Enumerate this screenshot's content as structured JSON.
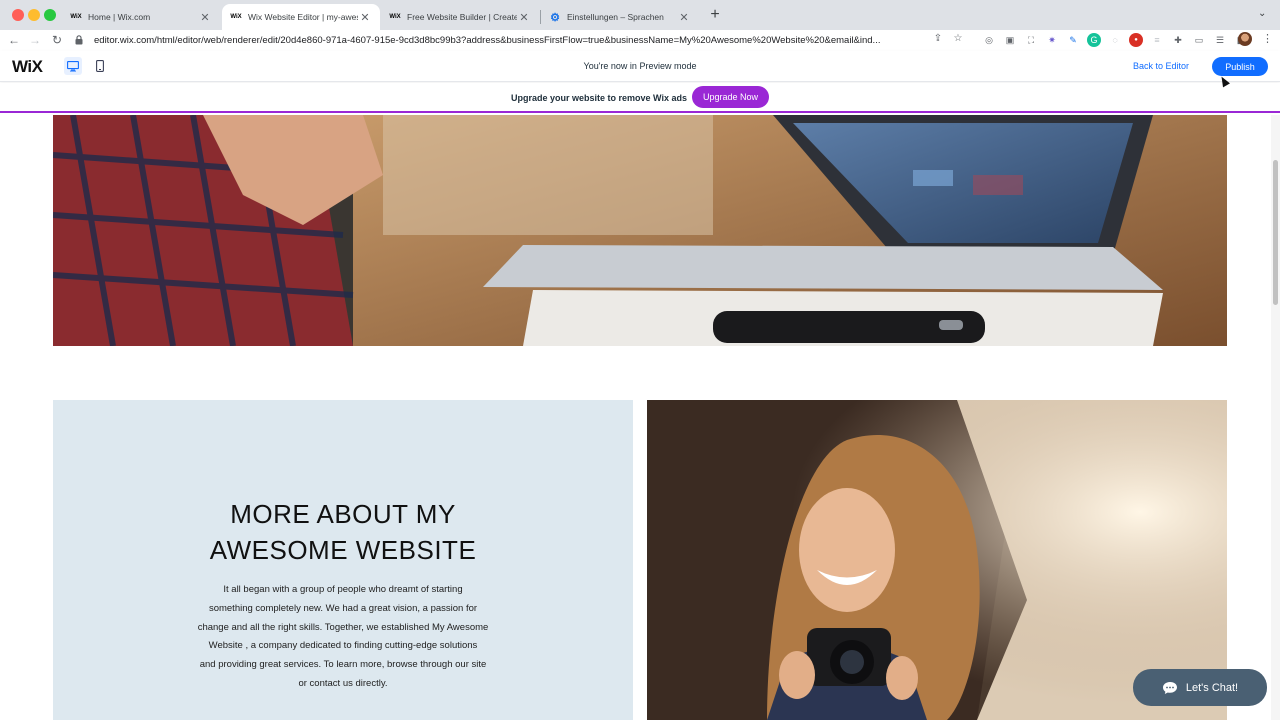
{
  "browser": {
    "tabs": [
      {
        "favicon": "WiX",
        "label": "Home | Wix.com"
      },
      {
        "favicon": "WiX",
        "label": "Wix Website Editor | my-awesome"
      },
      {
        "favicon": "WiX",
        "label": "Free Website Builder | Create a"
      },
      {
        "favicon": "gear-icon",
        "label": "Einstellungen – Sprachen"
      }
    ],
    "url": "editor.wix.com/html/editor/web/renderer/edit/20d4e860-971a-4607-915e-9cd3d8bc99b3?address&businessFirstFlow=true&businessName=My%20Awesome%20Website%20&email&ind..."
  },
  "wixbar": {
    "logo": "WiX",
    "preview_label": "You're now in Preview mode",
    "back_label": "Back to Editor",
    "publish_label": "Publish"
  },
  "adbar": {
    "text": "Upgrade your website to remove Wix ads",
    "upgrade_label": "Upgrade Now"
  },
  "about": {
    "title_line1": "MORE ABOUT MY",
    "title_line2": "AWESOME WEBSITE",
    "body_lines": [
      "It all began with a group of people who dreamt of starting",
      "something completely new. We had a great vision, a passion for",
      "change and all the right skills. Together, we established My Awesome",
      "Website , a company dedicated to finding cutting-edge solutions",
      "and providing great services. To learn more, browse through our site",
      "or contact us directly."
    ]
  },
  "chat": {
    "label": "Let's Chat!"
  },
  "colors": {
    "wix_blue": "#116dff",
    "ad_purple": "#9a27d5",
    "about_bg": "#dde8ef",
    "chat_bg": "#4a6073"
  }
}
